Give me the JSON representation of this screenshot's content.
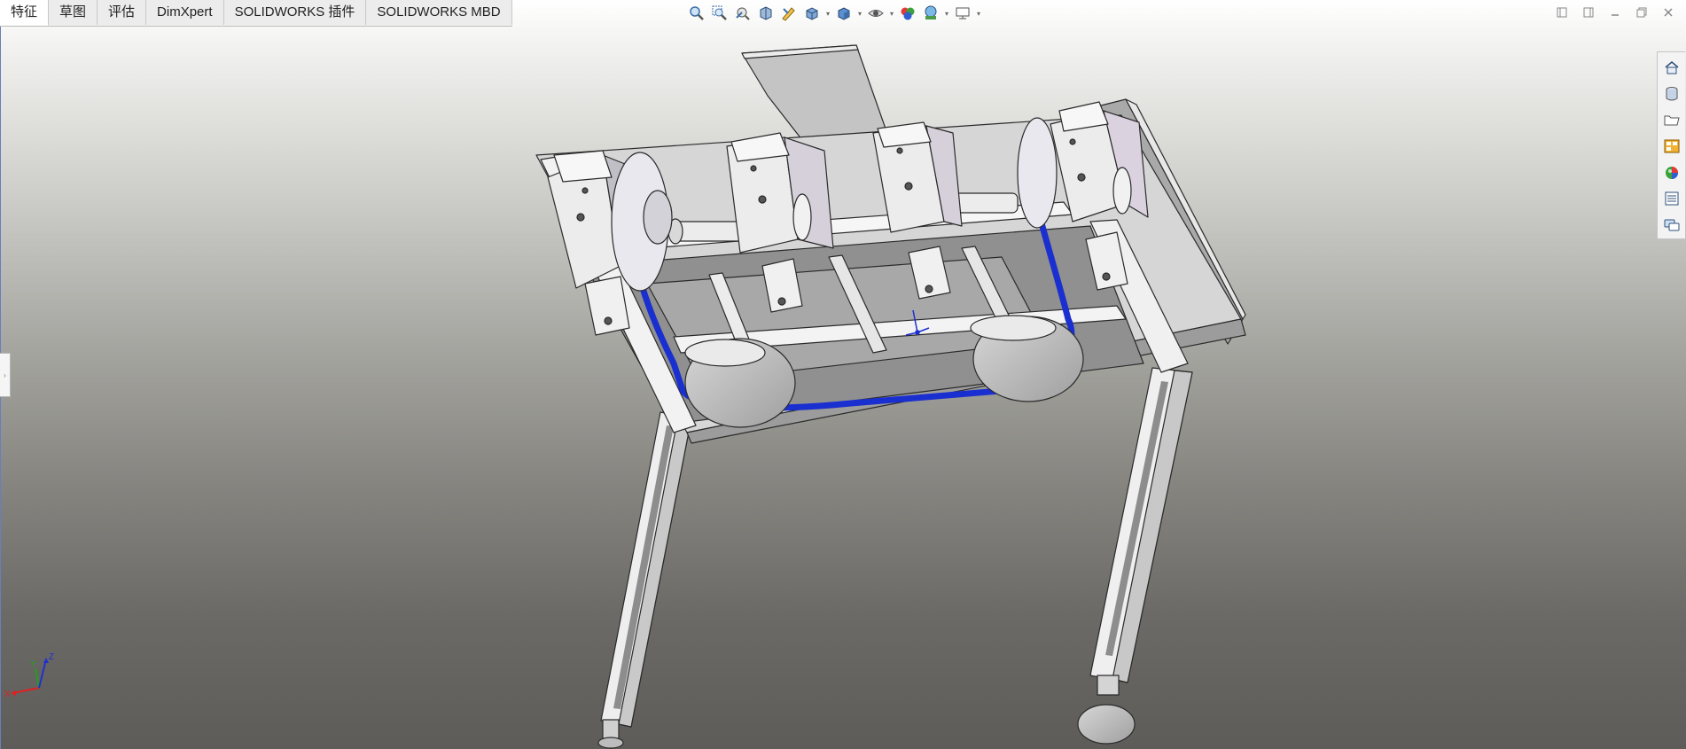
{
  "command_manager": {
    "tabs": [
      {
        "label": "特征",
        "active": true
      },
      {
        "label": "草图",
        "active": false
      },
      {
        "label": "评估",
        "active": false
      },
      {
        "label": "DimXpert",
        "active": false
      },
      {
        "label": "SOLIDWORKS 插件",
        "active": false
      },
      {
        "label": "SOLIDWORKS MBD",
        "active": false
      }
    ]
  },
  "heads_up_toolbar": {
    "tools": [
      "zoom-to-fit-icon",
      "zoom-to-area-icon",
      "previous-view-icon",
      "section-view-icon",
      "dynamic-annotation-icon",
      "view-orientation-icon",
      "display-style-icon",
      "hide-show-items-icon",
      "edit-appearance-icon",
      "apply-scene-icon",
      "view-settings-icon"
    ]
  },
  "window_controls": [
    "restore-pane-icon",
    "tile-pane-icon",
    "minimize-icon",
    "restore-icon",
    "close-icon"
  ],
  "task_pane": {
    "items": [
      "home-icon",
      "design-library-icon",
      "file-explorer-icon",
      "view-palette-icon",
      "appearances-icon",
      "custom-properties-icon",
      "forum-icon"
    ]
  },
  "triad": {
    "x_label": "X",
    "y_label": "Y",
    "z_label": "Z"
  },
  "colors": {
    "belt": "#1a2fcf",
    "triad_x": "#e02020",
    "triad_y": "#1fa01f",
    "triad_z": "#2030d0",
    "model_light": "#f4f4f6",
    "model_shade": "#bdbdc4"
  }
}
